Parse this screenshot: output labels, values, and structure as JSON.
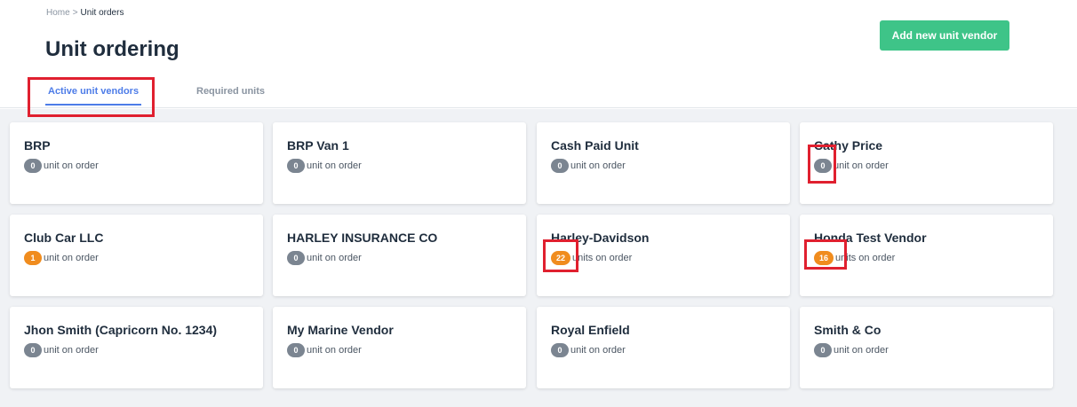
{
  "breadcrumb": {
    "home": "Home",
    "separator": ">",
    "current": "Unit orders"
  },
  "page": {
    "title": "Unit ordering"
  },
  "actions": {
    "add_vendor": "Add new unit vendor"
  },
  "tabs": [
    {
      "label": "Active unit vendors",
      "active": true
    },
    {
      "label": "Required units",
      "active": false
    }
  ],
  "vendors": [
    {
      "name": "BRP",
      "count": "0",
      "label": "unit on order"
    },
    {
      "name": "BRP Van 1",
      "count": "0",
      "label": "unit on order"
    },
    {
      "name": "Cash Paid Unit",
      "count": "0",
      "label": "unit on order"
    },
    {
      "name": "Cathy Price",
      "count": "0",
      "label": "unit on order"
    },
    {
      "name": "Club Car LLC",
      "count": "1",
      "label": "unit on order"
    },
    {
      "name": "HARLEY INSURANCE CO",
      "count": "0",
      "label": "unit on order"
    },
    {
      "name": "Harley-Davidson",
      "count": "22",
      "label": "units on order"
    },
    {
      "name": "Honda Test Vendor",
      "count": "16",
      "label": "units on order"
    },
    {
      "name": "Jhon Smith (Capricorn No. 1234)",
      "count": "0",
      "label": "unit on order"
    },
    {
      "name": "My Marine Vendor",
      "count": "0",
      "label": "unit on order"
    },
    {
      "name": "Royal Enfield",
      "count": "0",
      "label": "unit on order"
    },
    {
      "name": "Smith & Co",
      "count": "0",
      "label": "unit on order"
    }
  ],
  "colors": {
    "accent": "#4d7ce8",
    "primary_button": "#3ec488",
    "badge_gray": "#7b8591",
    "badge_orange": "#f08c1e",
    "highlight": "#e0202f"
  }
}
